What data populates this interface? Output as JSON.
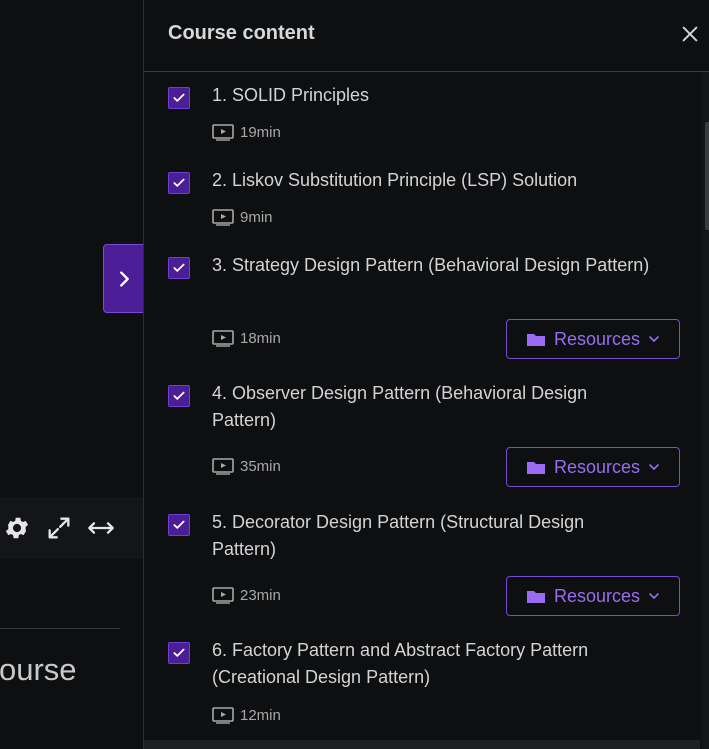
{
  "left": {
    "course_partial": "ourse"
  },
  "panel": {
    "title": "Course content"
  },
  "items": [
    {
      "title": "1. SOLID Principles",
      "duration": "19min"
    },
    {
      "title": "2. Liskov Substitution Principle (LSP) Solution",
      "duration": "9min"
    },
    {
      "title": "3. Strategy Design Pattern (Behavioral Design Pattern)",
      "duration": "18min",
      "resources": "Resources"
    },
    {
      "title": "4. Observer Design Pattern (Behavioral Design Pattern)",
      "duration": "35min",
      "resources": "Resources"
    },
    {
      "title": "5. Decorator Design Pattern (Structural Design Pattern)",
      "duration": "23min",
      "resources": "Resources"
    },
    {
      "title": "6. Factory Pattern and Abstract Factory Pattern (Creational Design Pattern)",
      "duration": "12min"
    }
  ],
  "icons": {
    "settings": "gear-icon",
    "fullscreen": "expand-icon",
    "theater": "arrows-horizontal-icon",
    "close": "close-icon",
    "expand_panel": "chevron-right-icon",
    "video": "video-icon",
    "folder": "folder-icon",
    "dropdown": "chevron-down-icon",
    "check": "check-icon"
  },
  "colors": {
    "accent": "#4b1d96",
    "accent_text": "#9b6cf0",
    "background": "#0e0f11"
  }
}
